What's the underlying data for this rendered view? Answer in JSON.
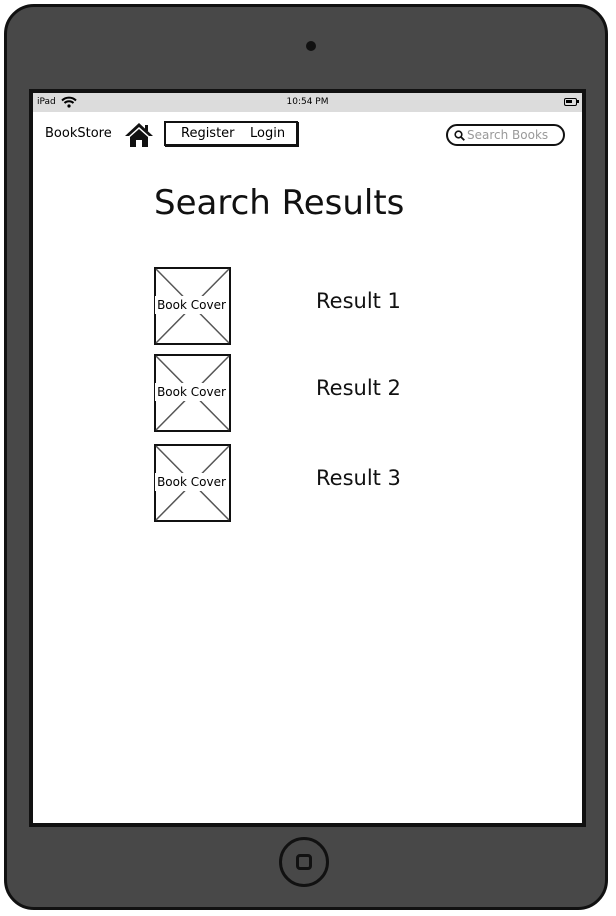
{
  "status_bar": {
    "carrier": "iPad",
    "time": "10:54 PM"
  },
  "header": {
    "brand": "BookStore",
    "register_label": "Register",
    "login_label": "Login",
    "search_placeholder": "Search Books"
  },
  "main": {
    "title": "Search Results",
    "results": [
      {
        "cover_label": "Book Cover",
        "label": "Result 1"
      },
      {
        "cover_label": "Book Cover",
        "label": "Result 2"
      },
      {
        "cover_label": "Book Cover",
        "label": "Result 3"
      }
    ]
  },
  "icons": {
    "home": "home-icon",
    "search": "search-icon",
    "wifi": "wifi-icon",
    "battery": "battery-icon"
  }
}
